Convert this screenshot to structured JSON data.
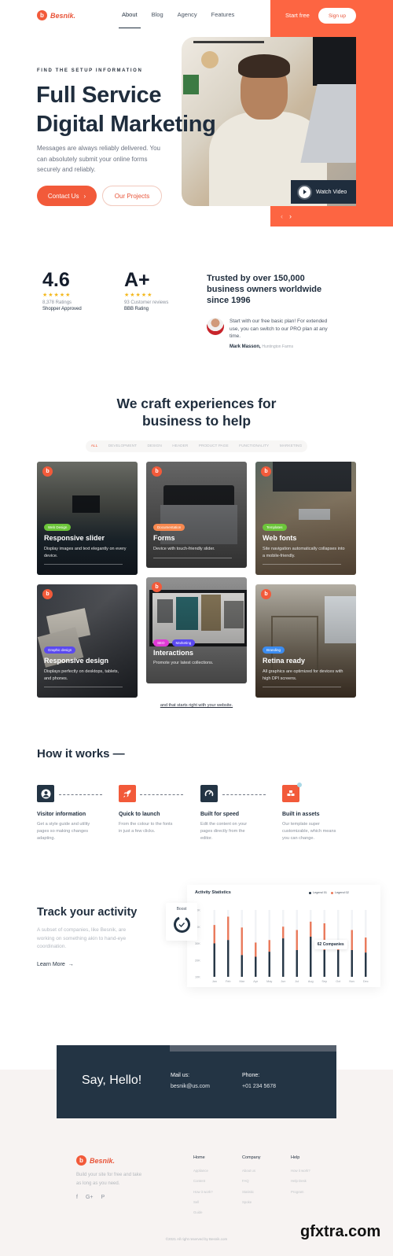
{
  "brand": {
    "name": "Besnik.",
    "mark": "b",
    "accent": "#f25a3a",
    "navy": "#233444"
  },
  "nav": {
    "items": [
      {
        "label": "About",
        "active": true
      },
      {
        "label": "Blog",
        "active": false
      },
      {
        "label": "Agency",
        "active": false
      },
      {
        "label": "Features",
        "active": false
      }
    ],
    "start_free": "Start free",
    "sign_up": "Sign up"
  },
  "hero": {
    "eyebrow": "FIND THE SETUP INFORMATION",
    "title_line1": "Full Service",
    "title_line2": "Digital Marketing",
    "description": "Messages are always reliably delivered. You can absolutely submit your online forms securely and reliably.",
    "contact_button": "Contact Us",
    "projects_button": "Our Projects",
    "watch_video": "Watch Video",
    "prev_icon": "chevron-left",
    "next_icon": "chevron-right"
  },
  "ratings": [
    {
      "score": "4.6",
      "stars": 5,
      "count": "8,378 Ratings",
      "source": "Shopper Approved"
    },
    {
      "score": "A+",
      "stars": 5,
      "count": "93 Customer reviews",
      "source": "BBB Rating"
    }
  ],
  "trust": {
    "title": "Trusted by over 150,000 business owners worldwide since 1996",
    "quote": "Start with our free basic plan! For extended use, you can switch to our PRO plan at any time.",
    "author": "Mark Masson,",
    "company": "Huntington Farms"
  },
  "craft": {
    "title_line1": "We craft experiences for",
    "title_line2": "business to help",
    "filters": [
      "ALL",
      "DEVELOPMENT",
      "DESIGN",
      "HEADER",
      "PRODUCT PAGE",
      "FUNCTIONALITY",
      "MARKETING"
    ],
    "active_filter": "ALL",
    "cards": [
      {
        "title": "Responsive slider",
        "desc": "Display images and text elegantly on every device.",
        "tags": [
          {
            "label": "Web Design",
            "color": "#6cc53a"
          }
        ]
      },
      {
        "title": "Forms",
        "desc": "Device with touch-friendly slider.",
        "tags": [
          {
            "label": "Documentation",
            "color": "#f7884f"
          }
        ]
      },
      {
        "title": "Web fonts",
        "desc": "Site navigation automatically collapses into a mobile-friendly.",
        "tags": [
          {
            "label": "Templates",
            "color": "#6cc53a"
          }
        ]
      },
      {
        "title": "Responsive design",
        "desc": "Displays perfectly on desktops, tablets, and phones.",
        "tags": [
          {
            "label": "Graphic design",
            "color": "#5a49f0"
          }
        ]
      },
      {
        "title": "Interactions",
        "desc": "Promote your latest collections.",
        "tags": [
          {
            "label": "SEO",
            "color": "#e03ad6"
          },
          {
            "label": "Marketing",
            "color": "#5a49f0"
          }
        ]
      },
      {
        "title": "Retina ready",
        "desc": "All graphics are optimized for devices with high DPI screens.",
        "tags": [
          {
            "label": "Branding",
            "color": "#3b8cf0"
          }
        ]
      }
    ],
    "more_link": "and that starts right with your website."
  },
  "how": {
    "title": "How it works —",
    "steps": [
      {
        "title": "Visitor information",
        "desc": "Get a style guide and utility pages so making changes adapting.",
        "icon": "user-icon",
        "color": "#233444"
      },
      {
        "title": "Quick to launch",
        "desc": "From the colour to the fonts in just a few clicks.",
        "icon": "rocket-icon",
        "color": "#f25a3a"
      },
      {
        "title": "Built for speed",
        "desc": "Edit the content on your pages directly from the editor.",
        "icon": "speedometer-icon",
        "color": "#233444"
      },
      {
        "title": "Built in assets",
        "desc": "Our template super customizable, which means you can change.",
        "icon": "assets-icon",
        "color": "#f25a3a"
      }
    ]
  },
  "track": {
    "title": "Track your activity",
    "desc": "A subset of companies, like Besnik, are working on something akin to hand-eye coordination.",
    "learn_more": "Learn More",
    "boost_label": "Boost"
  },
  "chart_data": {
    "type": "bar",
    "stacked": true,
    "title": "Activity Statistics",
    "categories": [
      "Jan",
      "Feb",
      "Mar",
      "Apr",
      "May",
      "Jun",
      "Jul",
      "Aug",
      "Sep",
      "Oct",
      "Nov",
      "Dec"
    ],
    "series": [
      {
        "name": "Legend 01",
        "color": "#233444",
        "values": [
          30,
          32,
          23,
          22,
          25,
          33,
          26,
          34,
          26,
          26,
          26,
          24.5
        ]
      },
      {
        "name": "Legend 02",
        "color": "#e9795a",
        "values": [
          11,
          14,
          16.5,
          8.5,
          7,
          7,
          12,
          9,
          16,
          1,
          12,
          9
        ]
      }
    ],
    "yticks": [
      "10K",
      "20K",
      "30K",
      "40K",
      "50K"
    ],
    "ylim": [
      10,
      50
    ],
    "yunit": "K",
    "grid": true,
    "legend": "top-right",
    "annotation": {
      "text": "62 Companies",
      "category": "Sep"
    }
  },
  "contact": {
    "heading": "Say, Hello!",
    "mail_label": "Mail us:",
    "mail": "besnik@us.com",
    "phone_label": "Phone:",
    "phone": "+01 234 5678"
  },
  "footer": {
    "desc": "Build your site for free and take as long as you need.",
    "socials": [
      "f",
      "G+",
      "P"
    ],
    "columns": [
      {
        "title": "Home",
        "links": [
          "Appliance",
          "Content",
          "How it work?",
          "Sell",
          "Guide"
        ]
      },
      {
        "title": "Company",
        "links": [
          "About us",
          "FAQ",
          "Statistic",
          "Spoke"
        ]
      },
      {
        "title": "Help",
        "links": [
          "How it work?",
          "Help Desk",
          "Program"
        ]
      }
    ],
    "copyright": "©2021 All right reserved by Besnik.com"
  },
  "watermark": "gfxtra.com"
}
